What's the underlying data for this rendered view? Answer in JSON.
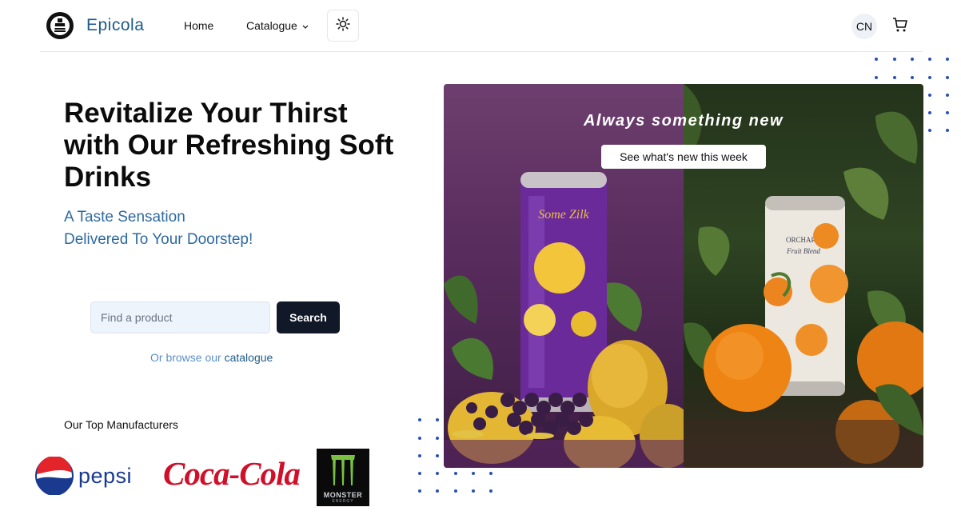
{
  "header": {
    "brand": "Epicola",
    "nav": {
      "home": "Home",
      "catalogue": "Catalogue"
    },
    "language": "CN"
  },
  "hero": {
    "title": "Revitalize Your Thirst with Our Refreshing Soft Drinks",
    "subtitle_line1": "A Taste Sensation",
    "subtitle_line2": "Delivered To Your Doorstep!"
  },
  "search": {
    "placeholder": "Find a product",
    "button": "Search",
    "browse_prefix": "Or browse our ",
    "browse_link": "catalogue"
  },
  "manufacturers": {
    "title": "Our Top Manufacturers",
    "items": [
      "pepsi",
      "Coca-Cola",
      "MONSTER"
    ]
  },
  "promo": {
    "tagline": "Always something new",
    "button": "See what's new this week"
  },
  "colors": {
    "brand": "#1e5a8a",
    "accent_dark": "#111827",
    "dots": "#2b4fb8"
  }
}
